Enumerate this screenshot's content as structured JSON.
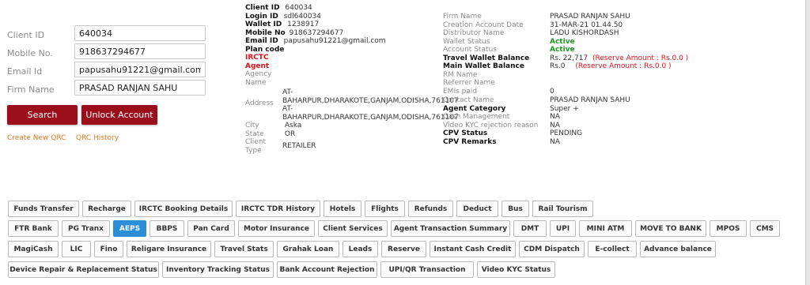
{
  "search_form": {
    "client_id": {
      "label": "Client ID",
      "value": "640034"
    },
    "mobile_no": {
      "label": "Mobile No.",
      "value": "918637294677"
    },
    "email_id": {
      "label": "Email Id",
      "value": "papusahu91221@gmail.com"
    },
    "firm_name": {
      "label": "Firm Name",
      "value": "PRASAD RANJAN SAHU"
    },
    "search_button": "Search",
    "unlock_button": "Unlock Account",
    "create_qrc_link": "Create New QRC",
    "qrc_history_link": "QRC History"
  },
  "client_info": {
    "client_id": {
      "label": "Client ID",
      "value": "640034"
    },
    "login_id": {
      "label": "Login ID",
      "value": "sdl640034"
    },
    "wallet_id": {
      "label": "Wallet ID",
      "value": "1238917"
    },
    "mobile_no": {
      "label": "Mobile No",
      "value": "918637294677"
    },
    "email_id": {
      "label": "Email ID",
      "value": "papusahu91221@gmail.com"
    },
    "plan_code": {
      "label": "Plan code",
      "value": ""
    },
    "irctc": {
      "label": "IRCTC",
      "value": ""
    },
    "agent": {
      "label": "Agent",
      "value": ""
    },
    "agency_name": {
      "label1": "Agency",
      "label2": "Name",
      "value": ""
    },
    "address": {
      "label": "Address",
      "lines": [
        "AT-",
        "BAHARPUR,DHARAKOTE,GANJAM,ODISHA,761107",
        "AT-",
        "BAHARPUR,DHARAKOTE,GANJAM,ODISHA,761107"
      ]
    },
    "city": {
      "label": "City",
      "value": "Aska"
    },
    "state": {
      "label": "State",
      "value": "OR"
    },
    "client_type": {
      "label1": "Client",
      "label2": "Type",
      "value": "RETAILER"
    }
  },
  "account_info": {
    "firm_name": {
      "label": "Firm Name",
      "value": "PRASAD RANJAN SAHU"
    },
    "creation_date": {
      "label": "Creation Account Date",
      "value": "31-MAR-21 01.44.50"
    },
    "distributor_name": {
      "label": "Distributor Name",
      "value": "LADU KISHORDASH"
    },
    "wallet_status": {
      "label": "Wallet Status",
      "value": "Active"
    },
    "account_status": {
      "label": "Account Status",
      "value": "Active"
    },
    "travel_wallet": {
      "label": "Travel Wallet Balance",
      "value": "Rs. 22,717",
      "reserve": "(Reserve Amount : Rs.0.0 )"
    },
    "main_wallet": {
      "label": "Main Wallet Balance",
      "value": "Rs.0",
      "reserve": "(Reserve Amount : Rs.0.0 )"
    },
    "rm_name": {
      "label": "RM Name",
      "value": ""
    },
    "referrer_name": {
      "label": "Referrer Name",
      "value": ""
    },
    "emis_paid": {
      "label": "EMIs paid",
      "value": "0"
    },
    "contact_name": {
      "label": "Contact Name",
      "value": "PRASAD RANJAN SAHU"
    },
    "agent_category": {
      "label": "Agent Category",
      "value": "Super +"
    },
    "cash_management": {
      "label": "Cash Management",
      "value": "NA"
    },
    "video_kyc_rejection": {
      "label": "Video KYC rejection reason",
      "value": "NA"
    },
    "cpv_status": {
      "label": "CPV Status",
      "value": "PENDING"
    },
    "cpv_remarks": {
      "label": "CPV Remarks",
      "value": "NA"
    }
  },
  "tabs_row1": [
    "Funds Transfer",
    "Recharge",
    "IRCTC Booking Details",
    "IRCTC TDR History",
    "Hotels",
    "Flights",
    "Refunds",
    "Deduct",
    "Bus",
    "Rail Tourism"
  ],
  "tabs_row2": [
    "FTR Bank",
    "PG Tranx",
    "AEPS",
    "BBPS",
    "Pan Card",
    "Motor Insurance",
    "Client Services",
    "Agent Transaction Summary",
    "DMT",
    "UPI",
    "MINI ATM",
    "MOVE TO BANK",
    "MPOS",
    "CMS"
  ],
  "tabs_row3": [
    "MagiCash",
    "LIC",
    "Fino",
    "Religare Insurance",
    "Travel Stats",
    "Grahak Loan",
    "Leads",
    "Reserve",
    "Instant Cash Credit",
    "CDM Dispatch",
    "E-collect",
    "Advance balance"
  ],
  "tabs_row4": [
    "Device Repair & Replacement Status",
    "Inventory Tracking Status",
    "Bank Account Rejection",
    "UPI/QR Transaction",
    "Video KYC Status"
  ],
  "active_tab": "AEPS",
  "colors": {
    "accent_red": "#9b0f1d",
    "active_tab": "#2d8ed8",
    "link_orange": "#e07b1f",
    "status_green": "#1f9a1f",
    "alert_red": "#e0101a"
  }
}
